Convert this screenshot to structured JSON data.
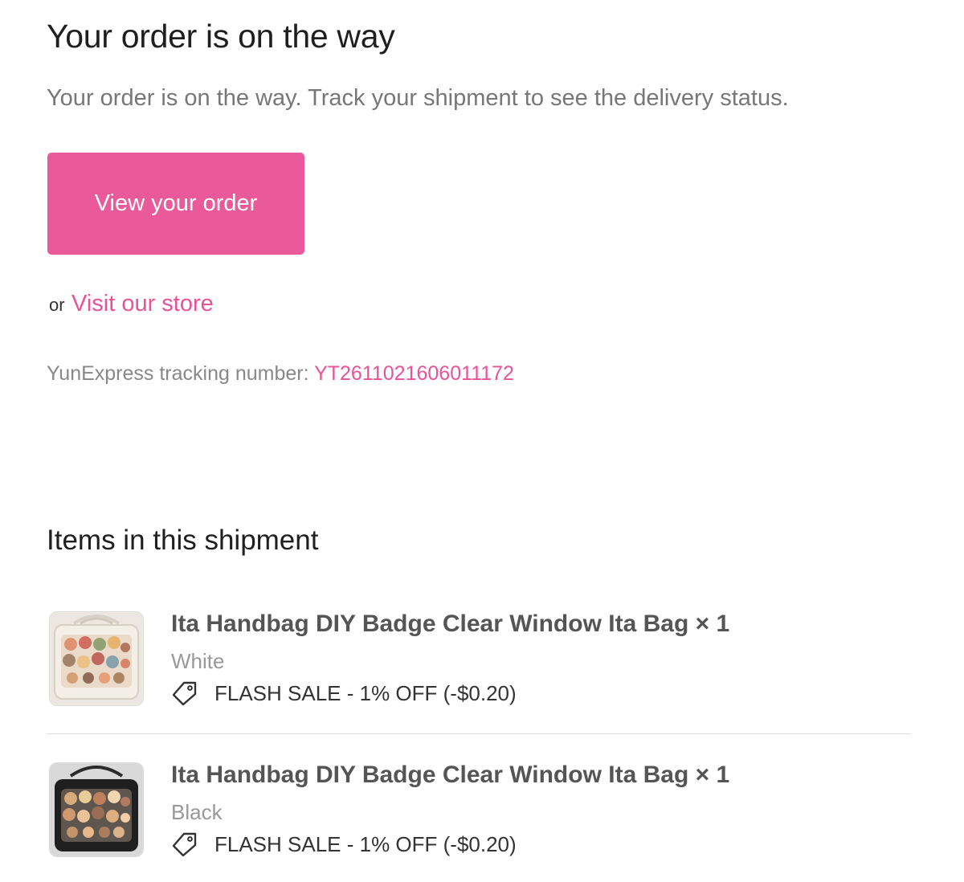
{
  "heading": "Your order is on the way",
  "subtext": "Your order is on the way. Track your shipment to see the delivery status.",
  "view_order_button": "View your order",
  "or_text": "or",
  "visit_store_link": "Visit our store",
  "tracking": {
    "label": "YunExpress tracking number:",
    "number": "YT2611021606011172"
  },
  "items_heading": "Items in this shipment",
  "items": [
    {
      "title": "Ita Handbag DIY Badge Clear Window Ita Bag × 1",
      "variant": "White",
      "discount": "FLASH SALE - 1% OFF (-$0.20)",
      "discount_icon": "tag-icon"
    },
    {
      "title": "Ita Handbag DIY Badge Clear Window Ita Bag × 1",
      "variant": "Black",
      "discount": "FLASH SALE - 1% OFF (-$0.20)",
      "discount_icon": "tag-icon"
    }
  ],
  "colors": {
    "accent": "#ea5a9b",
    "link": "#e9529a",
    "muted_text": "#777777"
  }
}
